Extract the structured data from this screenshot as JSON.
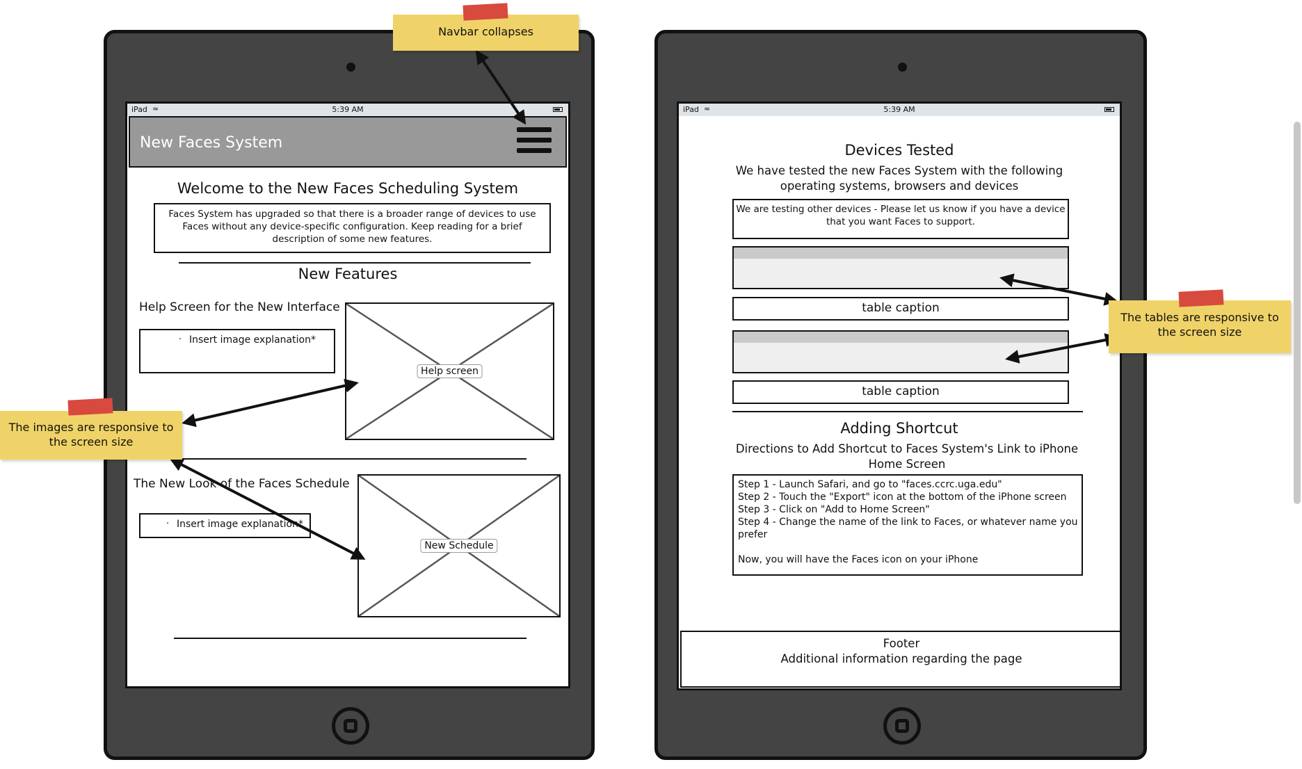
{
  "left_device": {
    "status": {
      "carrier": "iPad",
      "time": "5:39 AM"
    },
    "navbar": {
      "brand": "New Faces System"
    },
    "welcome_title": "Welcome to the New Faces Scheduling System",
    "intro_lines": [
      "Faces System has upgraded so that there is a broader range of devices to use",
      "Faces without any device-specific configuration. Keep reading for a brief",
      "description of some new features."
    ],
    "features_title": "New Features",
    "feature1": {
      "title": "Help Screen for the New Interface",
      "explanation": "Insert image explanation*",
      "image_label": "Help screen"
    },
    "feature2": {
      "title": "The New Look of the Faces Schedule",
      "explanation": "Insert image explanation*",
      "image_label": "New Schedule"
    }
  },
  "right_device": {
    "status": {
      "carrier": "iPad",
      "time": "5:39 AM"
    },
    "devices_title": "Devices Tested",
    "devices_sub_lines": [
      "We have tested the new Faces System with the following",
      "operating systems, browsers and devices"
    ],
    "testing_note_lines": [
      "We are testing other devices - Please let us know if you have a device",
      "that you want Faces to support."
    ],
    "table_captions": [
      "table caption",
      "table caption"
    ],
    "shortcut_title": "Adding Shortcut",
    "shortcut_sub_lines": [
      "Directions to Add Shortcut to Faces System's Link to iPhone",
      "Home Screen"
    ],
    "steps": [
      "Step 1 - Launch Safari, and go to \"faces.ccrc.uga.edu\"",
      "Step 2 - Touch the \"Export\" icon at the bottom of the iPhone screen",
      "Step 3 - Click on \"Add to Home Screen\"",
      "Step 4 - Change the name of the link to Faces, or whatever name you",
      "prefer",
      "",
      "Now, you will have the Faces icon on your iPhone"
    ],
    "footer": {
      "title": "Footer",
      "text": "Additional information regarding the page"
    }
  },
  "notes": {
    "navbar": "Navbar collapses",
    "images_lines": [
      "The images are responsive to",
      "the screen size"
    ],
    "tables_lines": [
      "The tables are responsive to",
      "the screen size"
    ]
  },
  "colors": {
    "device": "#444444",
    "note": "#f0d368",
    "tape": "#d84a3e",
    "navbar": "#999999"
  }
}
